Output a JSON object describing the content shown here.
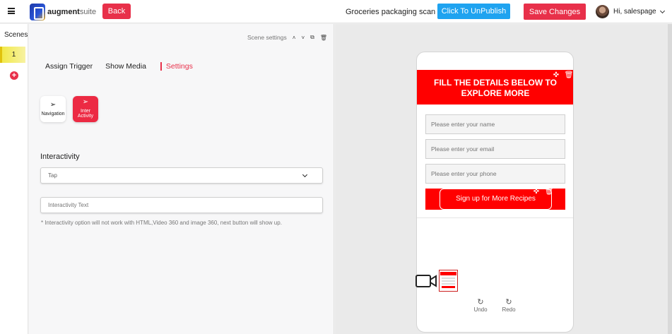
{
  "topbar": {
    "brand_bold": "augment",
    "brand_light": "suite",
    "back_label": "Back",
    "scan_title": "Groceries packaging scan",
    "unpublish_label": "Click To UnPublish",
    "save_label": "Save Changes",
    "greeting": "Hi, salespage",
    "accent_red": "#e8304a",
    "accent_blue": "#1fa3f0"
  },
  "scenes": {
    "title": "Scenes",
    "items": [
      {
        "label": "1"
      }
    ],
    "add_label": "+"
  },
  "panel": {
    "scene_settings_label": "Scene settings",
    "tabs": [
      {
        "label": "Assign Trigger"
      },
      {
        "label": "Show Media"
      },
      {
        "label": "Settings",
        "active": true
      }
    ],
    "type_cards": [
      {
        "label": "Navigation",
        "icon": "navigation-arrow-icon"
      },
      {
        "label": "Inter Activity",
        "icon": "navigation-arrow-icon",
        "selected": true
      }
    ],
    "section_title": "Interactivity",
    "select_value": "Tap",
    "text_placeholder": "Interactivity Text",
    "note": "* Interactivity option will not work with HTML,Video 360 and image 360, next button will show up."
  },
  "preview": {
    "banner_text": "FILL THE DETAILS BELOW TO EXPLORE MORE",
    "fields": [
      {
        "placeholder": "Please enter your name"
      },
      {
        "placeholder": "Please enter your email"
      },
      {
        "placeholder": "Please enter your phone"
      }
    ],
    "cta_label": "Sign up for More Recipes",
    "undo_label": "Undo",
    "redo_label": "Redo",
    "banner_color": "#ff0000"
  }
}
